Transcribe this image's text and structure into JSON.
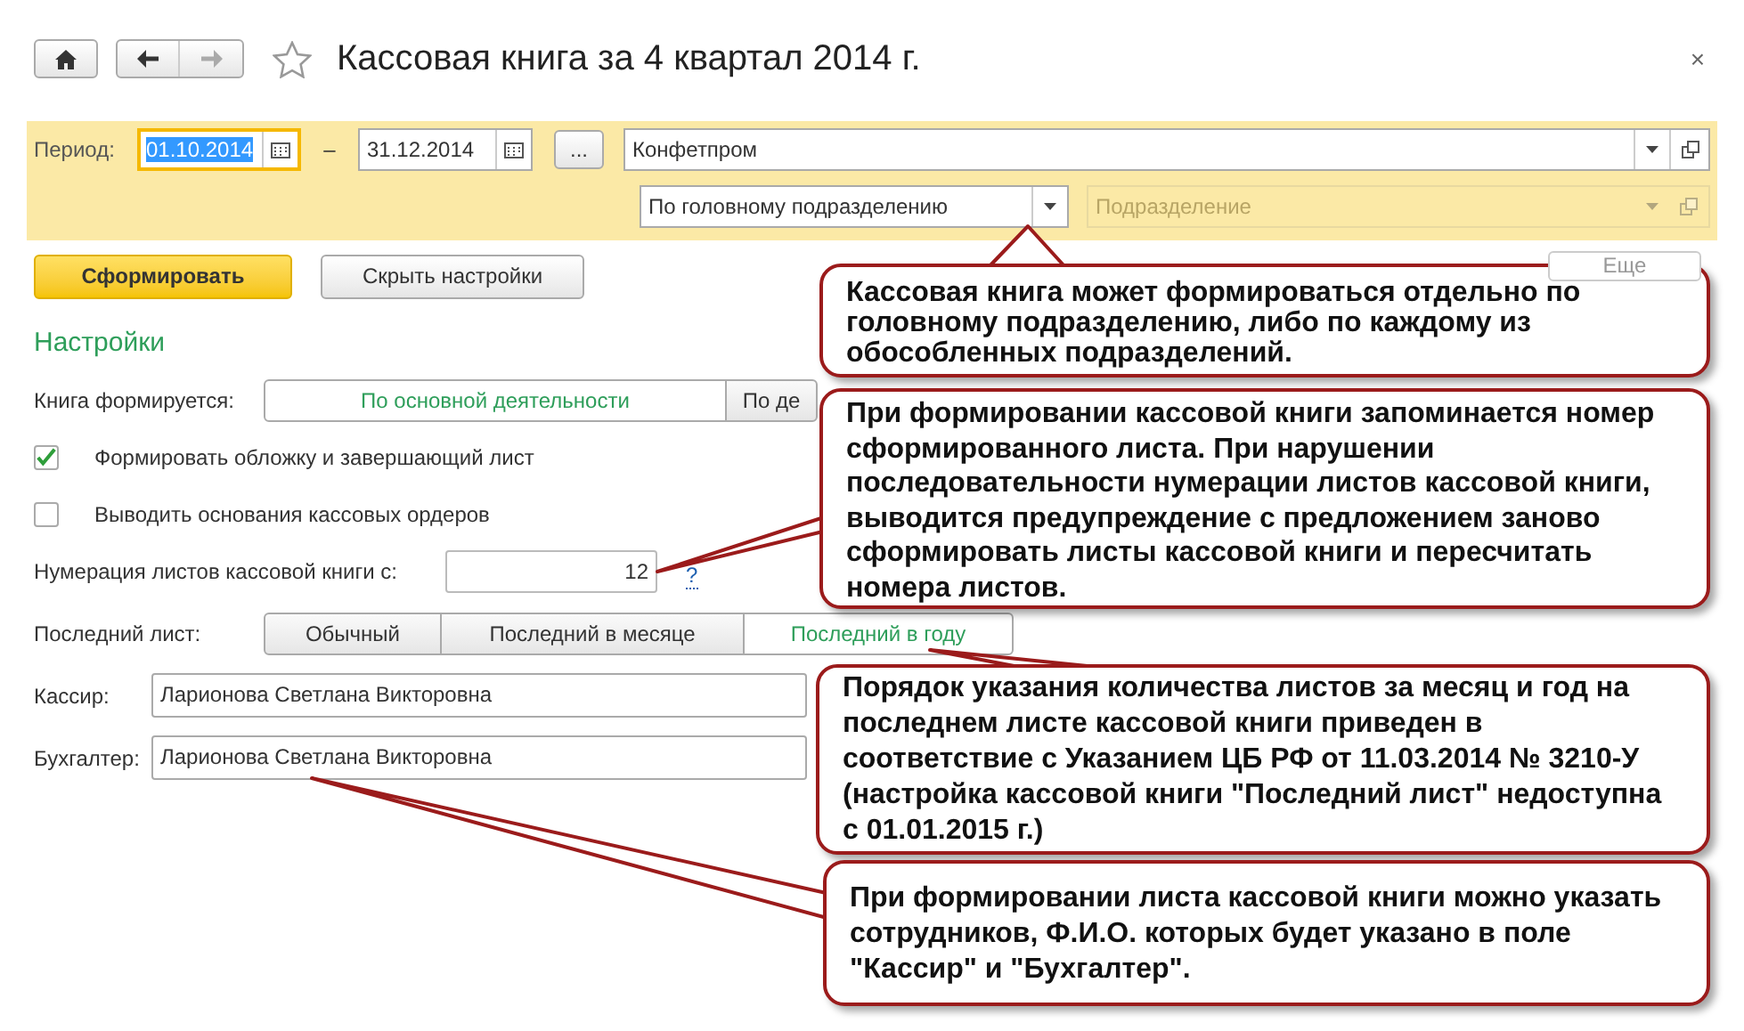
{
  "window": {
    "title": "Кассовая книга за 4 квартал 2014 г.",
    "close": "×"
  },
  "filter": {
    "period_label": "Период:",
    "date_from": {
      "value": "01.10.2014",
      "focused": true
    },
    "dash": "–",
    "date_to": {
      "value": "31.12.2014",
      "focused": false
    },
    "more_button": "...",
    "organization": "Конфетпром",
    "unit_mode": "По головному подразделению",
    "unit": {
      "placeholder": "Подразделение",
      "disabled": true
    }
  },
  "toolbar": {
    "buttons": [
      {
        "label": "Сформировать",
        "kind": "primary"
      },
      {
        "label": "Скрыть настройки",
        "kind": "default"
      }
    ],
    "more": "Еще"
  },
  "settings": {
    "title": "Настройки",
    "book_mode": {
      "label": "Книга формируется:",
      "options": [
        {
          "label": "По основной деятельности",
          "selected": true
        },
        {
          "label": "По де",
          "selected": false
        }
      ]
    },
    "checkboxes": [
      {
        "label": "Формировать обложку и завершающий лист",
        "checked": true
      },
      {
        "label": "Выводить основания кассовых ордеров",
        "checked": false
      }
    ],
    "numbering": {
      "label": "Нумерация листов кассовой книги с:",
      "value": "12",
      "help": "?"
    },
    "last_sheet": {
      "label": "Последний лист:",
      "options": [
        {
          "label": "Обычный",
          "selected": false
        },
        {
          "label": "Последний в месяце",
          "selected": false
        },
        {
          "label": "Последний в году",
          "selected": true
        }
      ]
    },
    "cashier": {
      "label": "Кассир:",
      "value": "Ларионова Светлана Викторовна"
    },
    "accountant": {
      "label": "Бухгалтер:",
      "value": "Ларионова Светлана Викторовна"
    }
  },
  "callouts": [
    {
      "text": "Кассовая книга может формироваться отдельно по головному подразделению, либо по каждому из обособленных подразделений."
    },
    {
      "text": "При формировании кассовой книги запоминается номер сформированного листа. При нарушении последовательности нумерации листов кассовой книги, выводится предупреждение с предложением заново сформировать листы кассовой книги и пересчитать номера листов."
    },
    {
      "text": "Порядок указания количества листов за месяц и год на последнем листе кассовой книги приведен в соответствие с Указанием ЦБ РФ от 11.03.2014 № 3210-У (настройка кассовой книги \"Последний лист\" недоступна с 01.01.2015 г.)"
    },
    {
      "text": "При формировании листа кассовой книги можно указать сотрудников, Ф.И.О. которых будет указано в поле \"Кассир\" и \"Бухгалтер\"."
    }
  ]
}
